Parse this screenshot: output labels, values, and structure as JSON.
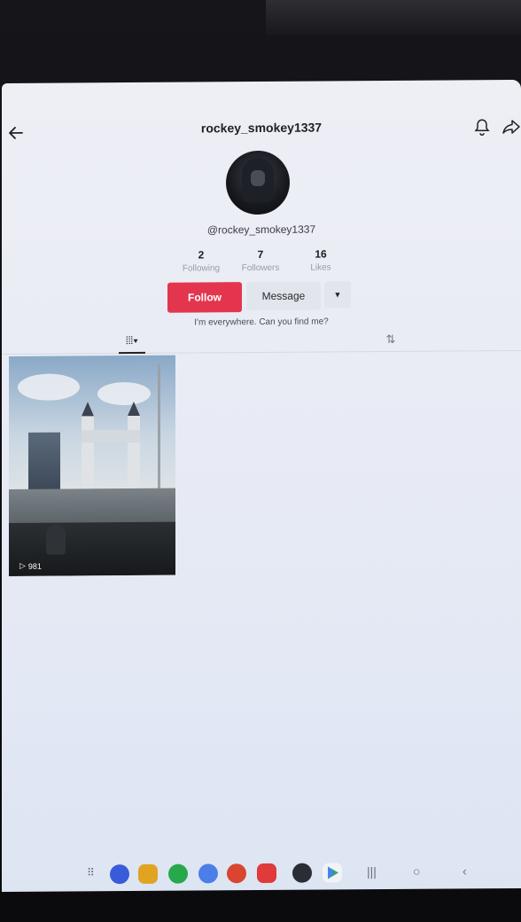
{
  "profile": {
    "title": "rockey_smokey1337",
    "handle": "@rockey_smokey1337",
    "bio": "I'm everywhere. Can you find me?",
    "stats": [
      {
        "value": "2",
        "label": "Following"
      },
      {
        "value": "7",
        "label": "Followers"
      },
      {
        "value": "16",
        "label": "Likes"
      }
    ]
  },
  "actions": {
    "follow_label": "Follow",
    "message_label": "Message"
  },
  "tabs": {
    "videos_icon": "grid-icon",
    "reposts_icon": "repost-icon"
  },
  "videos": [
    {
      "views": "981"
    }
  ],
  "colors": {
    "accent": "#e3364e"
  },
  "taskbar": {
    "apps": [
      "grid-icon",
      "samsung-internet-icon",
      "files-icon",
      "phone-icon",
      "messages-icon",
      "camera-icon",
      "video-icon",
      "settings-icon",
      "play-store-icon"
    ],
    "system": [
      "recents-icon",
      "home-icon",
      "back-icon"
    ]
  }
}
